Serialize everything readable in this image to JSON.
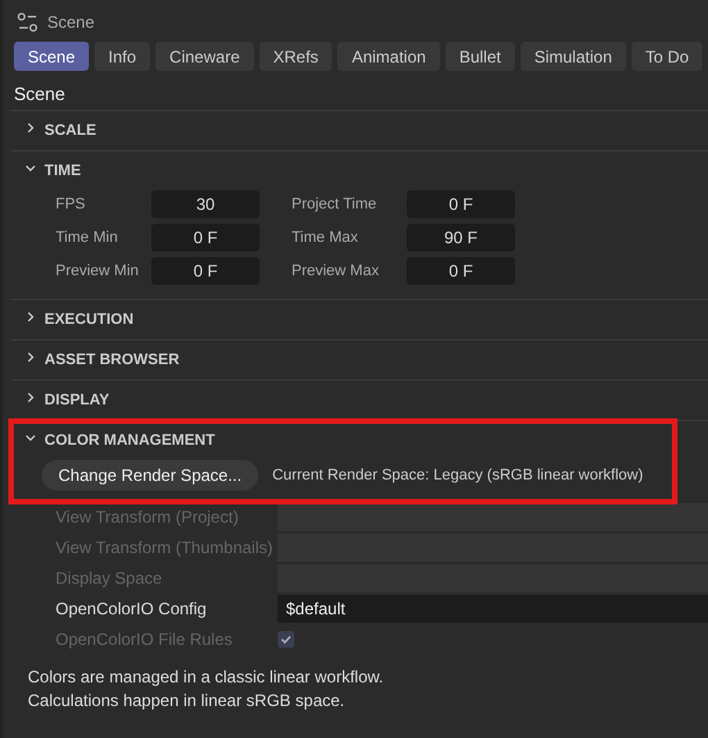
{
  "panel": {
    "title": "Scene"
  },
  "tabs": [
    {
      "label": "Scene",
      "selected": true
    },
    {
      "label": "Info",
      "selected": false
    },
    {
      "label": "Cineware",
      "selected": false
    },
    {
      "label": "XRefs",
      "selected": false
    },
    {
      "label": "Animation",
      "selected": false
    },
    {
      "label": "Bullet",
      "selected": false
    },
    {
      "label": "Simulation",
      "selected": false
    },
    {
      "label": "To Do",
      "selected": false
    }
  ],
  "heading": "Scene",
  "sections": [
    {
      "title": "SCALE",
      "expanded": false
    },
    {
      "title": "TIME",
      "expanded": true,
      "kind": "grid",
      "fields": [
        {
          "label": "FPS",
          "value": "30"
        },
        {
          "label": "Project Time",
          "value": "0 F"
        },
        {
          "label": "Time Min",
          "value": "0 F"
        },
        {
          "label": "Time Max",
          "value": "90 F"
        },
        {
          "label": "Preview Min",
          "value": "0 F"
        },
        {
          "label": "Preview Max",
          "value": "0 F"
        }
      ]
    },
    {
      "title": "EXECUTION",
      "expanded": false
    },
    {
      "title": "ASSET BROWSER",
      "expanded": false
    },
    {
      "title": "DISPLAY",
      "expanded": false
    },
    {
      "title": "COLOR MANAGEMENT",
      "expanded": true,
      "highlighted": true,
      "kind": "color",
      "button": "Change Render Space...",
      "status": "Current Render Space: Legacy (sRGB linear workflow)",
      "rows": [
        {
          "label": "View Transform (Project)",
          "kind": "select",
          "disabled": true
        },
        {
          "label": "View Transform (Thumbnails)",
          "kind": "select",
          "disabled": true
        },
        {
          "label": "Display Space",
          "kind": "select",
          "disabled": true
        },
        {
          "label": "OpenColorIO Config",
          "kind": "text",
          "value": "$default",
          "disabled": false
        },
        {
          "label": "OpenColorIO File Rules",
          "kind": "checkbox",
          "checked": true,
          "disabled": true
        }
      ],
      "notes": [
        "Colors are managed in a classic linear workflow.",
        "Calculations happen in linear sRGB space."
      ]
    }
  ]
}
